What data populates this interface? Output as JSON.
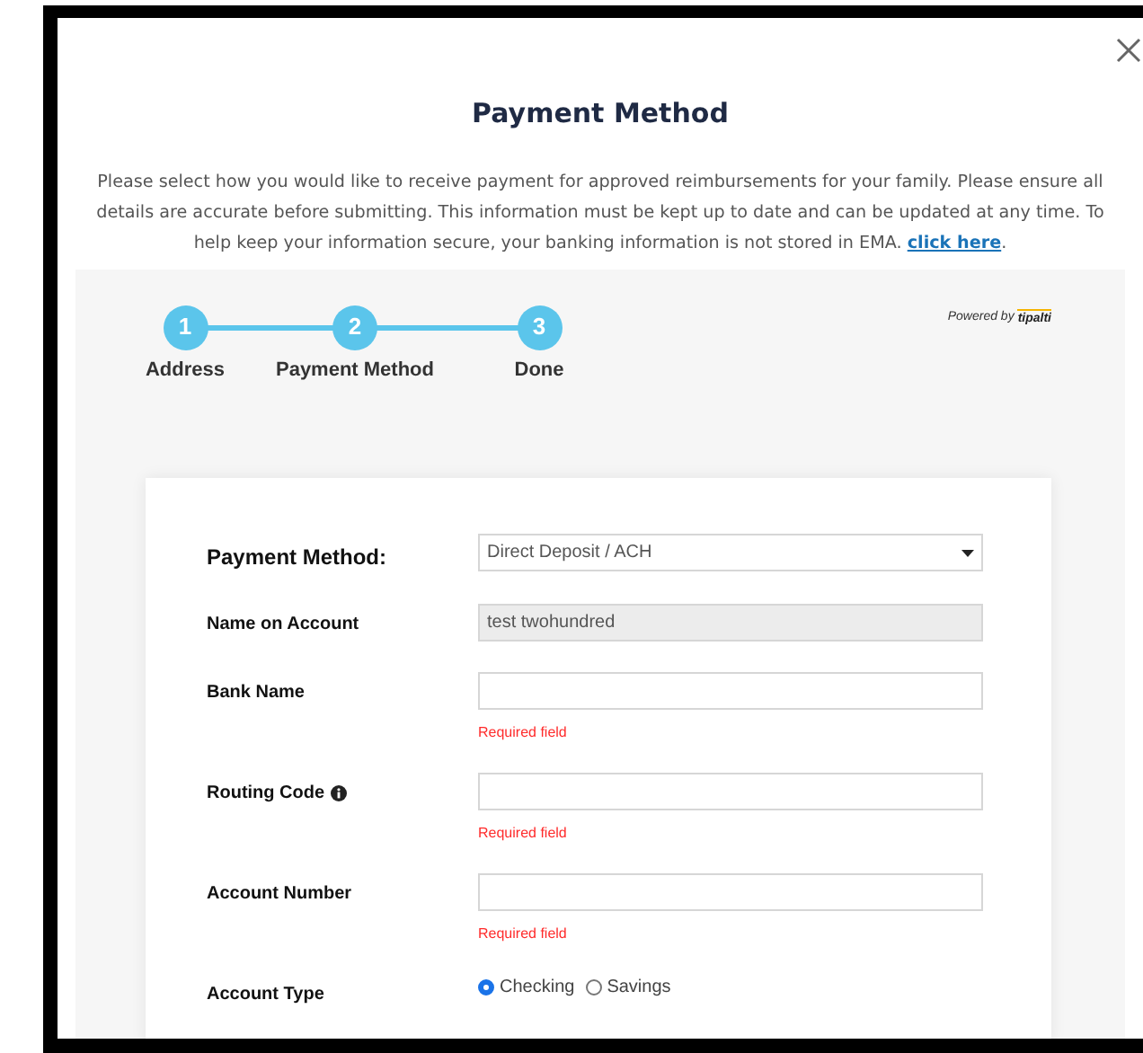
{
  "dialog": {
    "title": "Payment Method",
    "intro": "Please select how you would like to receive payment for approved reimbursements for your family. Please ensure all details are accurate before submitting. This information must be kept up to date and can be updated at any time. To help keep your information secure, your banking information is not stored in EMA.",
    "link": "click here",
    "after_link": "."
  },
  "powered_by": {
    "label": "Powered by",
    "brand": "tipalti"
  },
  "steps": [
    {
      "number": "1",
      "label": "Address"
    },
    {
      "number": "2",
      "label": "Payment Method"
    },
    {
      "number": "3",
      "label": "Done"
    }
  ],
  "form": [
    {
      "kind": "select",
      "label": "Payment Method:",
      "value": "Direct Deposit / ACH"
    },
    {
      "kind": "readonly",
      "label": "Name on Account",
      "value": "test twohundred"
    },
    {
      "kind": "text",
      "label": "Bank Name",
      "error": "Required field"
    },
    {
      "kind": "text",
      "label": "Routing Code",
      "info": true,
      "error": "Required field"
    },
    {
      "kind": "text",
      "label": "Account Number",
      "error": "Required field"
    },
    {
      "kind": "radio",
      "label": "Account Type",
      "options": [
        {
          "label": "Checking",
          "selected": true
        },
        {
          "label": "Savings",
          "selected": false
        }
      ]
    }
  ]
}
